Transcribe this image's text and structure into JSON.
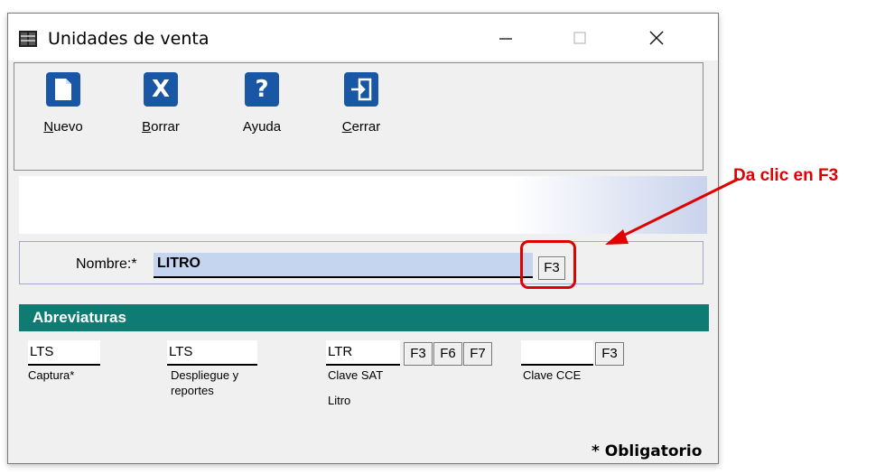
{
  "window": {
    "title": "Unidades de venta"
  },
  "toolbar": {
    "nuevo": {
      "accel": "N",
      "rest": "uevo"
    },
    "borrar": {
      "accel": "B",
      "rest": "orrar"
    },
    "ayuda": {
      "label": "Ayuda"
    },
    "cerrar": {
      "accel": "C",
      "rest": "errar"
    }
  },
  "nombre": {
    "label": "Nombre:*",
    "value": "LITRO",
    "button": "F3"
  },
  "abreviaturas": {
    "header": "Abreviaturas",
    "captura": {
      "value": "LTS",
      "caption": "Captura*"
    },
    "despliegue": {
      "value": "LTS",
      "caption": "Despliegue y reportes"
    },
    "clave_sat": {
      "value": "LTR",
      "caption": "Clave SAT",
      "sub": "Litro",
      "buttons": [
        "F3",
        "F6",
        "F7"
      ]
    },
    "clave_cce": {
      "value": "",
      "caption": "Clave CCE",
      "button": "F3"
    }
  },
  "footer": {
    "required_note": "* Obligatorio"
  },
  "annotation": {
    "text": "Da clic en F3"
  },
  "colors": {
    "accent_bar": "#0f7c73",
    "toolbar_icon": "#1a56a6",
    "annotation": "#e00000",
    "input_bg": "#c5d5f0"
  },
  "icons": [
    "app-icon",
    "new-document-icon",
    "delete-x-icon",
    "help-question-icon",
    "exit-door-icon",
    "minimize-icon",
    "maximize-icon",
    "close-icon"
  ]
}
